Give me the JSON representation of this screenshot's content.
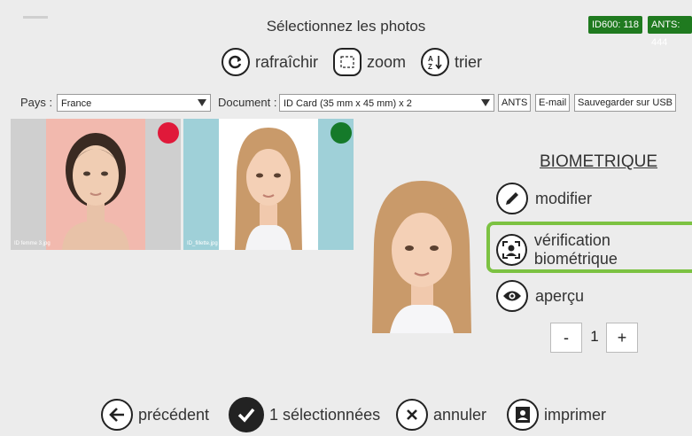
{
  "header": {
    "title": "Sélectionnez les photos",
    "badge_id600": "ID600: 118",
    "badge_ants": "ANTS: 444"
  },
  "toolbar": {
    "refresh_label": "rafraîchir",
    "zoom_label": "zoom",
    "sort_label": "trier"
  },
  "filters": {
    "country_label": "Pays :",
    "country_value": "France",
    "document_label": "Document :",
    "document_value": "ID Card (35 mm x 45 mm) x 2",
    "ants_label": "ANTS",
    "email_label": "E-mail",
    "usb_label": "Sauvegarder sur USB"
  },
  "photos": [
    {
      "filename": "ID femme 3.jpg",
      "status_color": "#e0193a",
      "bg": "#f2b9ae",
      "side": "#cfcfcf",
      "selected": false
    },
    {
      "filename": "ID_fillette.jpg",
      "status_color": "#157a2a",
      "bg": "#ffffff",
      "side": "#9fd0d8",
      "selected": true
    }
  ],
  "side_panel": {
    "heading": "BIOMETRIQUE",
    "modify_label": "modifier",
    "verify_label": "vérification biométrique",
    "preview_label": "aperçu",
    "quantity": "1",
    "minus_label": "-",
    "plus_label": "+",
    "highlight_color": "#7cc242"
  },
  "footer": {
    "previous_label": "précédent",
    "selected_label": "1 sélectionnées",
    "cancel_label": "annuler",
    "print_label": "imprimer"
  }
}
